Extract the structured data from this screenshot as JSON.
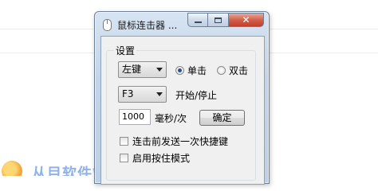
{
  "window": {
    "title": "鼠标连击器 ...",
    "controls": {
      "minimize": "minimize",
      "maximize": "maximize",
      "close": "✕"
    }
  },
  "settings": {
    "group_label": "设置",
    "mouse_button": {
      "selected": "左键"
    },
    "click_mode": {
      "single_label": "单击",
      "double_label": "双击",
      "selected": "single"
    },
    "hotkey": {
      "selected": "F3",
      "label": "开始/停止"
    },
    "interval": {
      "value": "1000",
      "unit_label": "毫秒/次",
      "confirm_label": "确定"
    },
    "options": [
      {
        "label": "连击前发送一次快捷键",
        "checked": false
      },
      {
        "label": "启用按住模式",
        "checked": false
      }
    ]
  },
  "background": {
    "logo_text": "从目软件站"
  }
}
